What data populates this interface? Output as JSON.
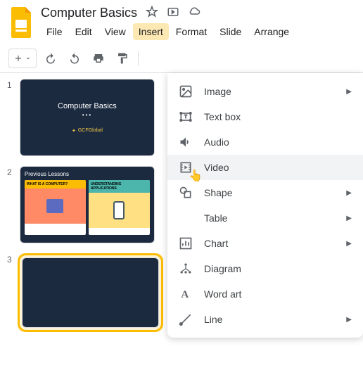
{
  "header": {
    "title": "Computer Basics"
  },
  "menubar": {
    "items": [
      "File",
      "Edit",
      "View",
      "Insert",
      "Format",
      "Slide",
      "Arrange"
    ],
    "active_index": 3
  },
  "slides": [
    {
      "num": "1",
      "title": "Computer Basics",
      "logo": "GCFGlobal"
    },
    {
      "num": "2",
      "header": "Previous Lessons",
      "card1": "WHAT IS A COMPUTER?",
      "card2": "UNDERSTANDING APPLICATIONS"
    },
    {
      "num": "3"
    }
  ],
  "dropdown": {
    "items": [
      {
        "label": "Image",
        "icon": "image",
        "submenu": true
      },
      {
        "label": "Text box",
        "icon": "textbox",
        "submenu": false
      },
      {
        "label": "Audio",
        "icon": "audio",
        "submenu": false
      },
      {
        "label": "Video",
        "icon": "video",
        "submenu": false,
        "hover": true
      },
      {
        "label": "Shape",
        "icon": "shape",
        "submenu": true
      },
      {
        "label": "Table",
        "icon": "table",
        "submenu": true
      },
      {
        "label": "Chart",
        "icon": "chart",
        "submenu": true
      },
      {
        "label": "Diagram",
        "icon": "diagram",
        "submenu": false
      },
      {
        "label": "Word art",
        "icon": "wordart",
        "submenu": false
      },
      {
        "label": "Line",
        "icon": "line",
        "submenu": true
      }
    ]
  }
}
